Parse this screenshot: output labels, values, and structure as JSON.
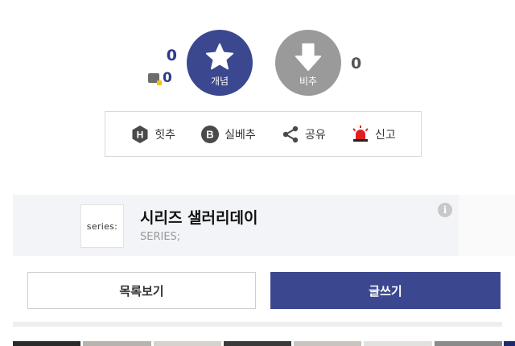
{
  "vote": {
    "up_count": "0",
    "comment_count": "0",
    "up_label": "개념",
    "down_label": "비추",
    "down_count": "0",
    "up_color": "#3b4890",
    "down_color": "#9a9a9a"
  },
  "actions": [
    {
      "label": "힛추",
      "icon": "hit-badge-icon"
    },
    {
      "label": "실베추",
      "icon": "b-badge-icon"
    },
    {
      "label": "공유",
      "icon": "share-icon"
    },
    {
      "label": "신고",
      "icon": "siren-icon"
    }
  ],
  "series": {
    "logo_text": "series:",
    "title": "시리즈 샐러리데이",
    "subtitle": "SERIES;",
    "info_icon": "info-icon"
  },
  "buttons": {
    "list": "목록보기",
    "write": "글쓰기"
  },
  "thumbs": [
    "#2a2a2a",
    "#b9b3ad",
    "#d7d2cc",
    "#3a3a3a",
    "#c9c4bd",
    "#e3e1de",
    "#8a8a8a"
  ]
}
